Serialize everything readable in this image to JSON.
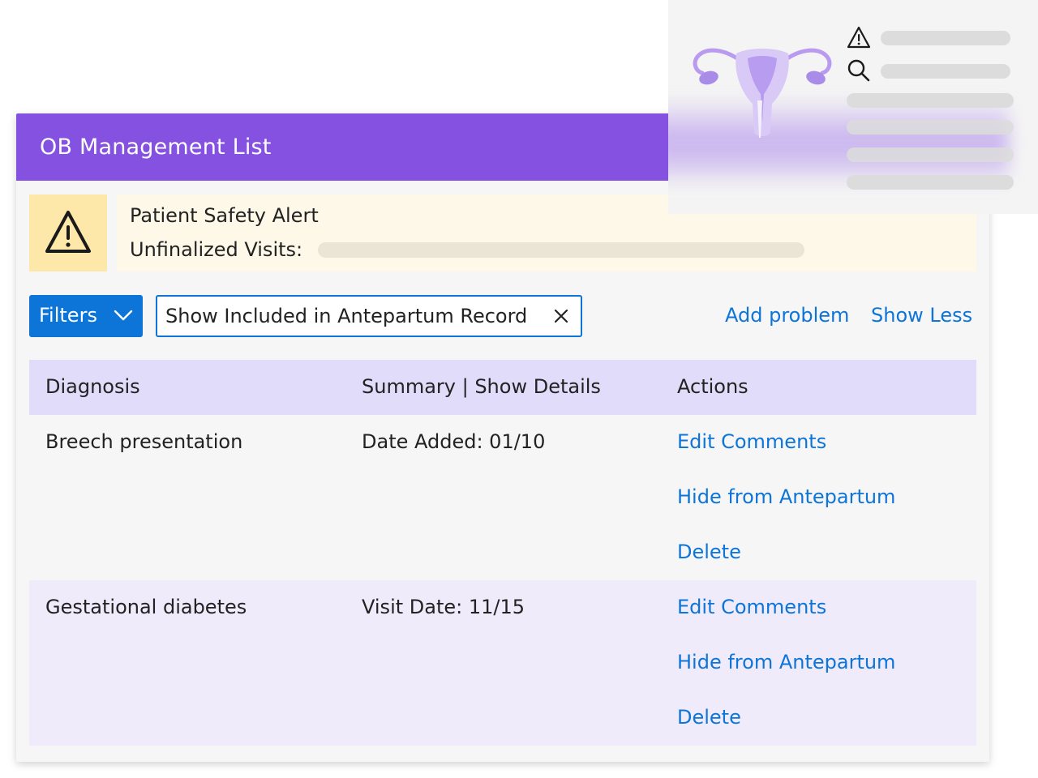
{
  "card": {
    "title": "OB Management List"
  },
  "alert": {
    "icon": "warning-triangle-icon",
    "title": "Patient Safety Alert",
    "unfinalized_label": "Unfinalized Visits:"
  },
  "toolbar": {
    "filters_label": "Filters",
    "filters_icon": "chevron-down-icon",
    "chip_label": "Show Included in Antepartum Record",
    "chip_close_icon": "close-icon",
    "add_problem": "Add problem",
    "show_less": "Show Less"
  },
  "table": {
    "headers": [
      "Diagnosis",
      "Summary | Show Details",
      "Actions"
    ],
    "rows": [
      {
        "diagnosis": "Breech presentation",
        "summary": "Date Added: 01/10",
        "actions": [
          "Edit Comments",
          "Hide from Antepartum",
          "Delete"
        ]
      },
      {
        "diagnosis": "Gestational diabetes",
        "summary": "Visit Date: 11/15",
        "actions": [
          "Edit Comments",
          "Hide from Antepartum",
          "Delete"
        ]
      }
    ]
  },
  "overlay": {
    "illustration": "uterus-illustration",
    "icons": [
      "warning-triangle-icon",
      "search-icon"
    ]
  },
  "colors": {
    "header_purple": "#8451e0",
    "link_blue": "#0d74d8",
    "alert_yellow": "#fde7a9",
    "table_header": "#e0dcf9"
  }
}
